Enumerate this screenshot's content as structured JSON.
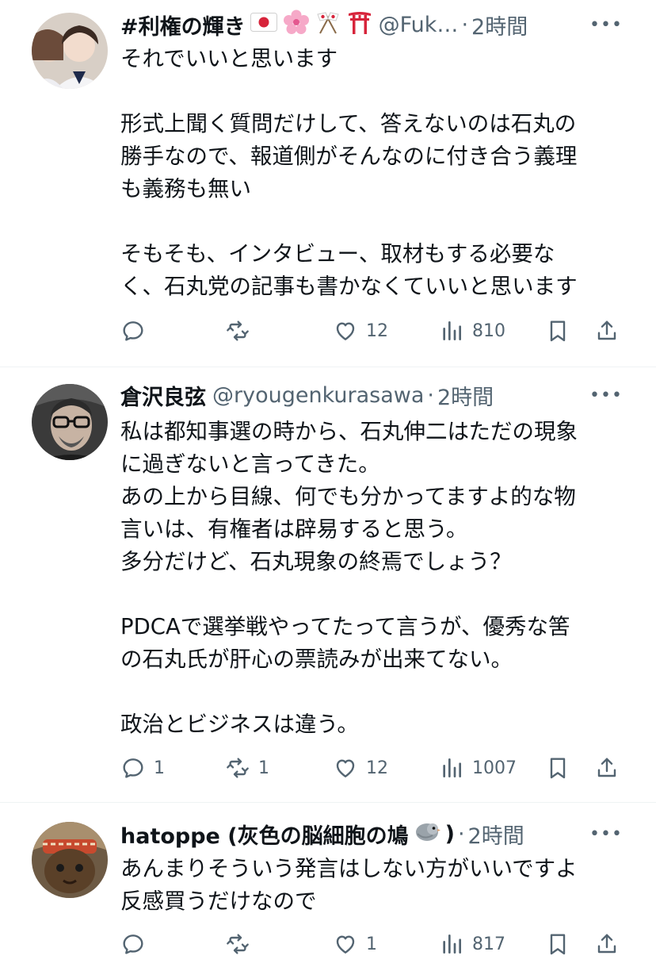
{
  "tweets": [
    {
      "name": "#利権の輝き",
      "handle": "@Fuk…",
      "time": "2時間",
      "lines": [
        "それでいいと思います",
        "",
        "形式上聞く質問だけして、答えないのは石丸の",
        "勝手なので、報道側がそんなのに付き合う義理",
        "も義務も無い",
        "",
        "そもそも、インタビュー、取材もする必要な",
        "く、石丸党の記事も書かなくていいと思います"
      ],
      "replies": "",
      "reposts": "",
      "likes": "12",
      "views": "810"
    },
    {
      "name": "倉沢良弦",
      "handle": "@ryougenkurasawa",
      "time": "2時間",
      "lines": [
        "私は都知事選の時から、石丸伸二はただの現象",
        "に過ぎないと言ってきた。",
        "あの上から目線、何でも分かってますよ的な物",
        "言いは、有権者は辟易すると思う。",
        "多分だけど、石丸現象の終焉でしょう？",
        "",
        "PDCAで選挙戦やってたって言うが、優秀な筈",
        "の石丸氏が肝心の票読みが出来てない。",
        "",
        "政治とビジネスは違う。"
      ],
      "replies": "1",
      "reposts": "1",
      "likes": "12",
      "views": "1007"
    },
    {
      "name": "hatoppe (灰色の脳細胞の鳩",
      "name_suffix": ")",
      "handle": "",
      "time": "2時間",
      "lines": [
        "あんまりそういう発言はしない方がいいですよ",
        "反感買うだけなので"
      ],
      "replies": "",
      "reposts": "",
      "likes": "1",
      "views": "817"
    }
  ],
  "ui": {
    "separator": "·",
    "more": "•••"
  },
  "colors": {
    "text": "#0f1419",
    "secondary": "#536471",
    "divider": "#eff3f4"
  },
  "icons": [
    "reply-icon",
    "repost-icon",
    "like-icon",
    "views-icon",
    "bookmark-icon",
    "share-icon",
    "more-icon"
  ]
}
